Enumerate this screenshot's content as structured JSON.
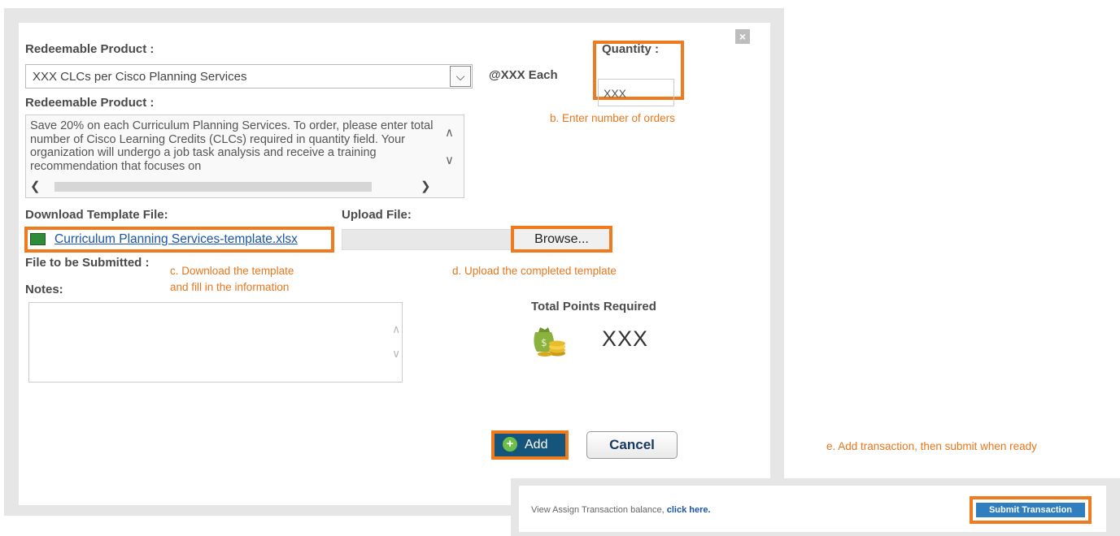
{
  "dialog": {
    "close_label": "×",
    "redeemable_label": "Redeemable Product :",
    "product_select_value": "XXX CLCs per Cisco Planning Services",
    "price_text": "@XXX Each",
    "quantity_label": "Quantity :",
    "quantity_value": "XXX",
    "description_label": "Redeemable Product :",
    "description_text": "Save 20% on each Curriculum Planning Services. To order, please enter total number of Cisco Learning Credits (CLCs) required in quantity field. Your organization will undergo a job task analysis and receive a training recommendation that focuses on",
    "download_label": "Download Template File:",
    "template_link": "Curriculum Planning Services-template.xlsx",
    "upload_label": "Upload File:",
    "browse_label": "Browse...",
    "file_submitted_label": "File to be Submitted :",
    "notes_label": "Notes:",
    "total_points_label": "Total Points Required",
    "total_points_value": "XXX",
    "add_label": "Add",
    "cancel_label": "Cancel"
  },
  "annotations": {
    "b": "b. Enter number of orders",
    "c1": "c. Download the template",
    "c2": "and fill in the information",
    "d": "d. Upload the completed template",
    "e": "e. Add transaction, then submit when ready"
  },
  "footer": {
    "balance_text": "View Assign Transaction balance, ",
    "balance_link": "click here.",
    "submit_label": "Submit Transaction"
  },
  "colors": {
    "highlight": "#f07b1e",
    "annotation_text": "#e8761c",
    "link": "#1a55a8",
    "add_button": "#15557c",
    "submit_button": "#2f7fc0"
  }
}
